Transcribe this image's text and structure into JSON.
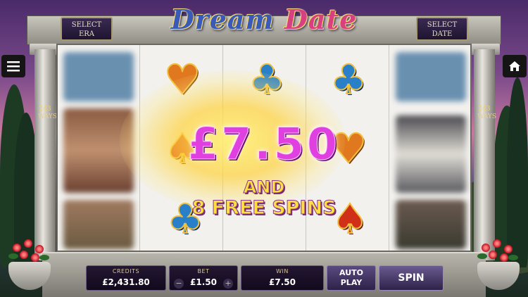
{
  "game": {
    "title_word1": "Dream",
    "title_word2": "Date"
  },
  "top_controls": {
    "select_era_line1": "SELECT",
    "select_era_line2": "ERA",
    "select_date_line1": "SELECT",
    "select_date_line2": "DATE"
  },
  "side_controls": {
    "menu_icon": "hamburger-menu-icon",
    "home_icon": "home-icon"
  },
  "pillars": {
    "ways_text": "243 WAYS"
  },
  "reels": {
    "symbols": [
      "heart",
      "club",
      "club",
      "spade",
      "heart",
      "club",
      "spade"
    ],
    "colors": {
      "heart": "#e07820",
      "club": "#2a80c8",
      "spade": "#d03018"
    }
  },
  "win_message": {
    "amount": "£7.50",
    "and": "AND",
    "free_spins": "8 FREE SPINS"
  },
  "control_bar": {
    "credits_label": "CREDITS",
    "credits_value": "£2,431.80",
    "bet_label": "BET",
    "bet_value": "£1.50",
    "bet_decrease": "−",
    "bet_increase": "+",
    "win_label": "WIN",
    "win_value": "£7.50",
    "autoplay_line1": "AUTO",
    "autoplay_line2": "PLAY",
    "spin_label": "SPIN"
  }
}
